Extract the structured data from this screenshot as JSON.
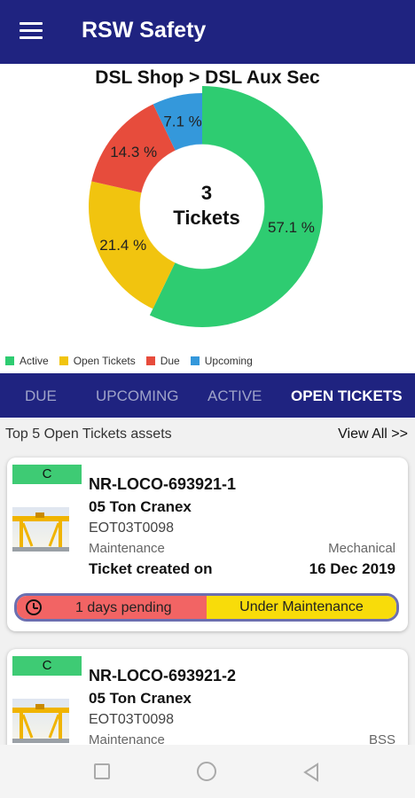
{
  "header": {
    "title": "RSW Safety",
    "menu_icon": "hamburger-menu-icon"
  },
  "chart_data": {
    "type": "pie",
    "title": "DSL Shop > DSL Aux Sec",
    "center_label": [
      "3",
      "Tickets"
    ],
    "slices": [
      {
        "label": "Active",
        "value": 57.1,
        "display": "57.1 %",
        "color": "#2ecc71"
      },
      {
        "label": "Open Tickets",
        "value": 21.4,
        "display": "21.4 %",
        "color": "#f1c40f"
      },
      {
        "label": "Due",
        "value": 14.3,
        "display": "14.3 %",
        "color": "#e74c3c"
      },
      {
        "label": "Upcoming",
        "value": 7.1,
        "display": "7.1 %",
        "color": "#3498db"
      }
    ],
    "legend": "bottom-left"
  },
  "tabs": [
    {
      "label": "DUE",
      "active": false
    },
    {
      "label": "UPCOMING",
      "active": false
    },
    {
      "label": "ACTIVE",
      "active": false
    },
    {
      "label": "OPEN TICKETS",
      "active": true
    }
  ],
  "section": {
    "title": "Top 5 Open Tickets assets",
    "view_all": "View All >>"
  },
  "cards": [
    {
      "badge": "C",
      "asset_id": "NR-LOCO-693921-1",
      "name": "05 Ton Cranex",
      "code": "EOT03T0098",
      "category": "Maintenance",
      "department": "Mechanical",
      "ticket_label": "Ticket created on",
      "ticket_date": "16 Dec 2019",
      "pending": "1 days pending",
      "status": "Under Maintenance"
    },
    {
      "badge": "C",
      "asset_id": "NR-LOCO-693921-2",
      "name": "05 Ton Cranex",
      "code": "EOT03T0098",
      "category": "Maintenance",
      "department": "BSS"
    }
  ],
  "colors": {
    "appbar": "#1f2380",
    "active": "#2ecc71",
    "open": "#f1c40f",
    "due": "#e74c3c",
    "upcoming": "#3498db",
    "pending": "#f26464",
    "maintenance": "#f8dc0a"
  }
}
